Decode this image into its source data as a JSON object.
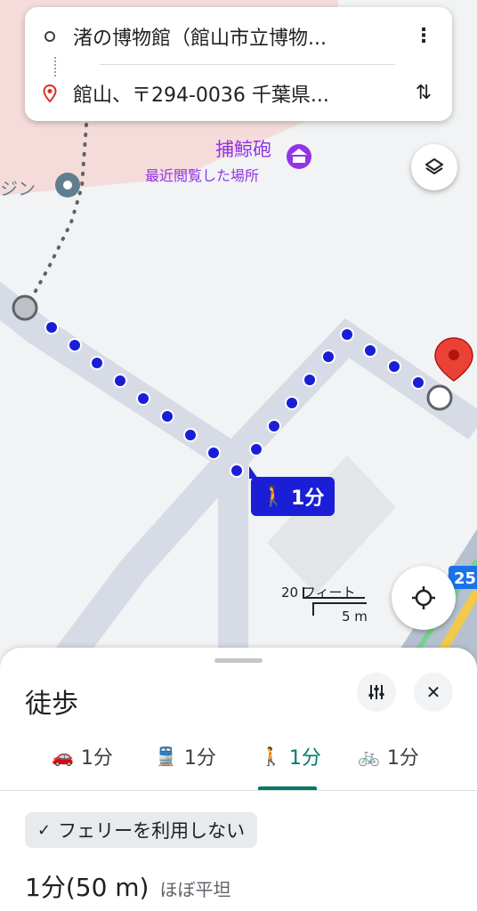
{
  "route": {
    "origin": "渚の博物館（館山市立博物...",
    "destination": "館山、〒294-0036 千葉県..."
  },
  "map": {
    "poi_name": "捕鯨砲",
    "poi_sub": "最近閲覧した場所",
    "left_edge_label": "ジン",
    "badge_time": "1分",
    "scale_feet": "20 フィート",
    "scale_m": "5 m",
    "highway_label": "25",
    "colors": {
      "route": "#1a1fd6",
      "pin": "#d93025",
      "poi": "#9334e6",
      "road": "#d6dbe6"
    }
  },
  "sheet": {
    "title": "徒歩",
    "tabs": [
      {
        "mode": "車",
        "icon": "car-icon",
        "label": "1分"
      },
      {
        "mode": "公共交通機関",
        "icon": "train-icon",
        "label": "1分"
      },
      {
        "mode": "徒歩",
        "icon": "walk-icon",
        "label": "1分"
      },
      {
        "mode": "自転車",
        "icon": "bike-icon",
        "label": "1分"
      }
    ],
    "active_tab": "徒歩",
    "chip": "フェリーを利用しない",
    "summary_time": "1分",
    "summary_distance": "(50 m)",
    "summary_note": "ほぼ平坦"
  }
}
